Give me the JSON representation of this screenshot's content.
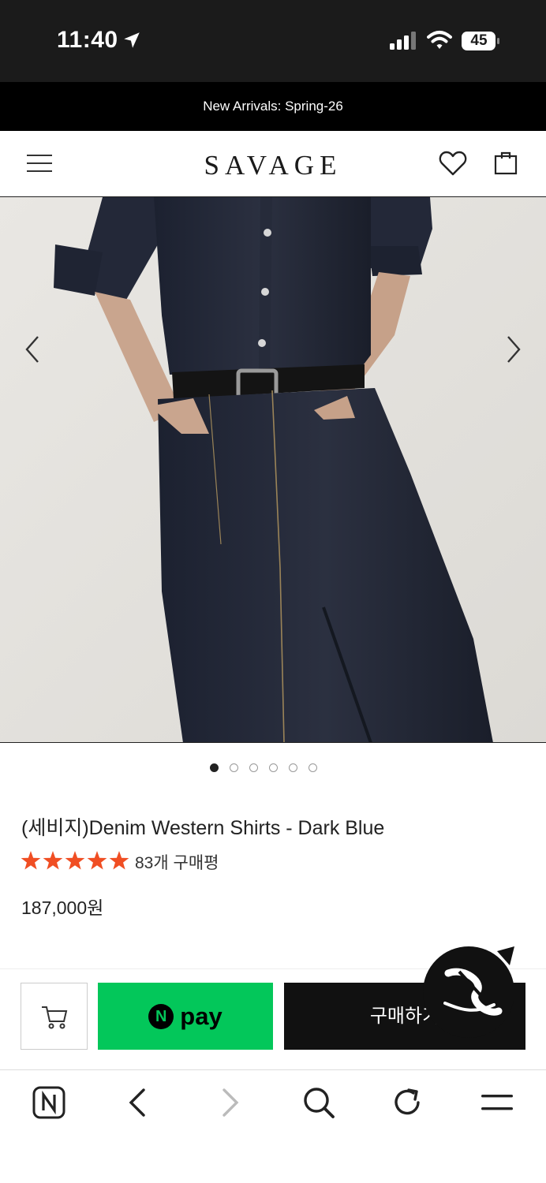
{
  "status_bar": {
    "time": "11:40",
    "battery": "45"
  },
  "announcement": "New Arrivals: Spring-26",
  "header": {
    "logo": "SAVAGE"
  },
  "carousel": {
    "dot_count": 6,
    "active_index": 0
  },
  "product": {
    "name": "(세비지)Denim Western Shirts - Dark Blue",
    "rating": 5,
    "rating_max": 5,
    "review_count": "83개 구매평",
    "price": "187,000원"
  },
  "purchase_bar": {
    "npay_n": "N",
    "npay_label": "pay",
    "buy_label": "구매하기"
  },
  "colors": {
    "npay_green": "#03c75a",
    "star_orange": "#f04e23",
    "dark": "#111111"
  },
  "icons": {
    "header": [
      "menu-icon",
      "heart-icon",
      "shopping-bag-icon"
    ],
    "toolbar": [
      "naver-n-icon",
      "back-icon",
      "forward-icon",
      "search-icon",
      "refresh-icon",
      "menu-icon"
    ]
  }
}
